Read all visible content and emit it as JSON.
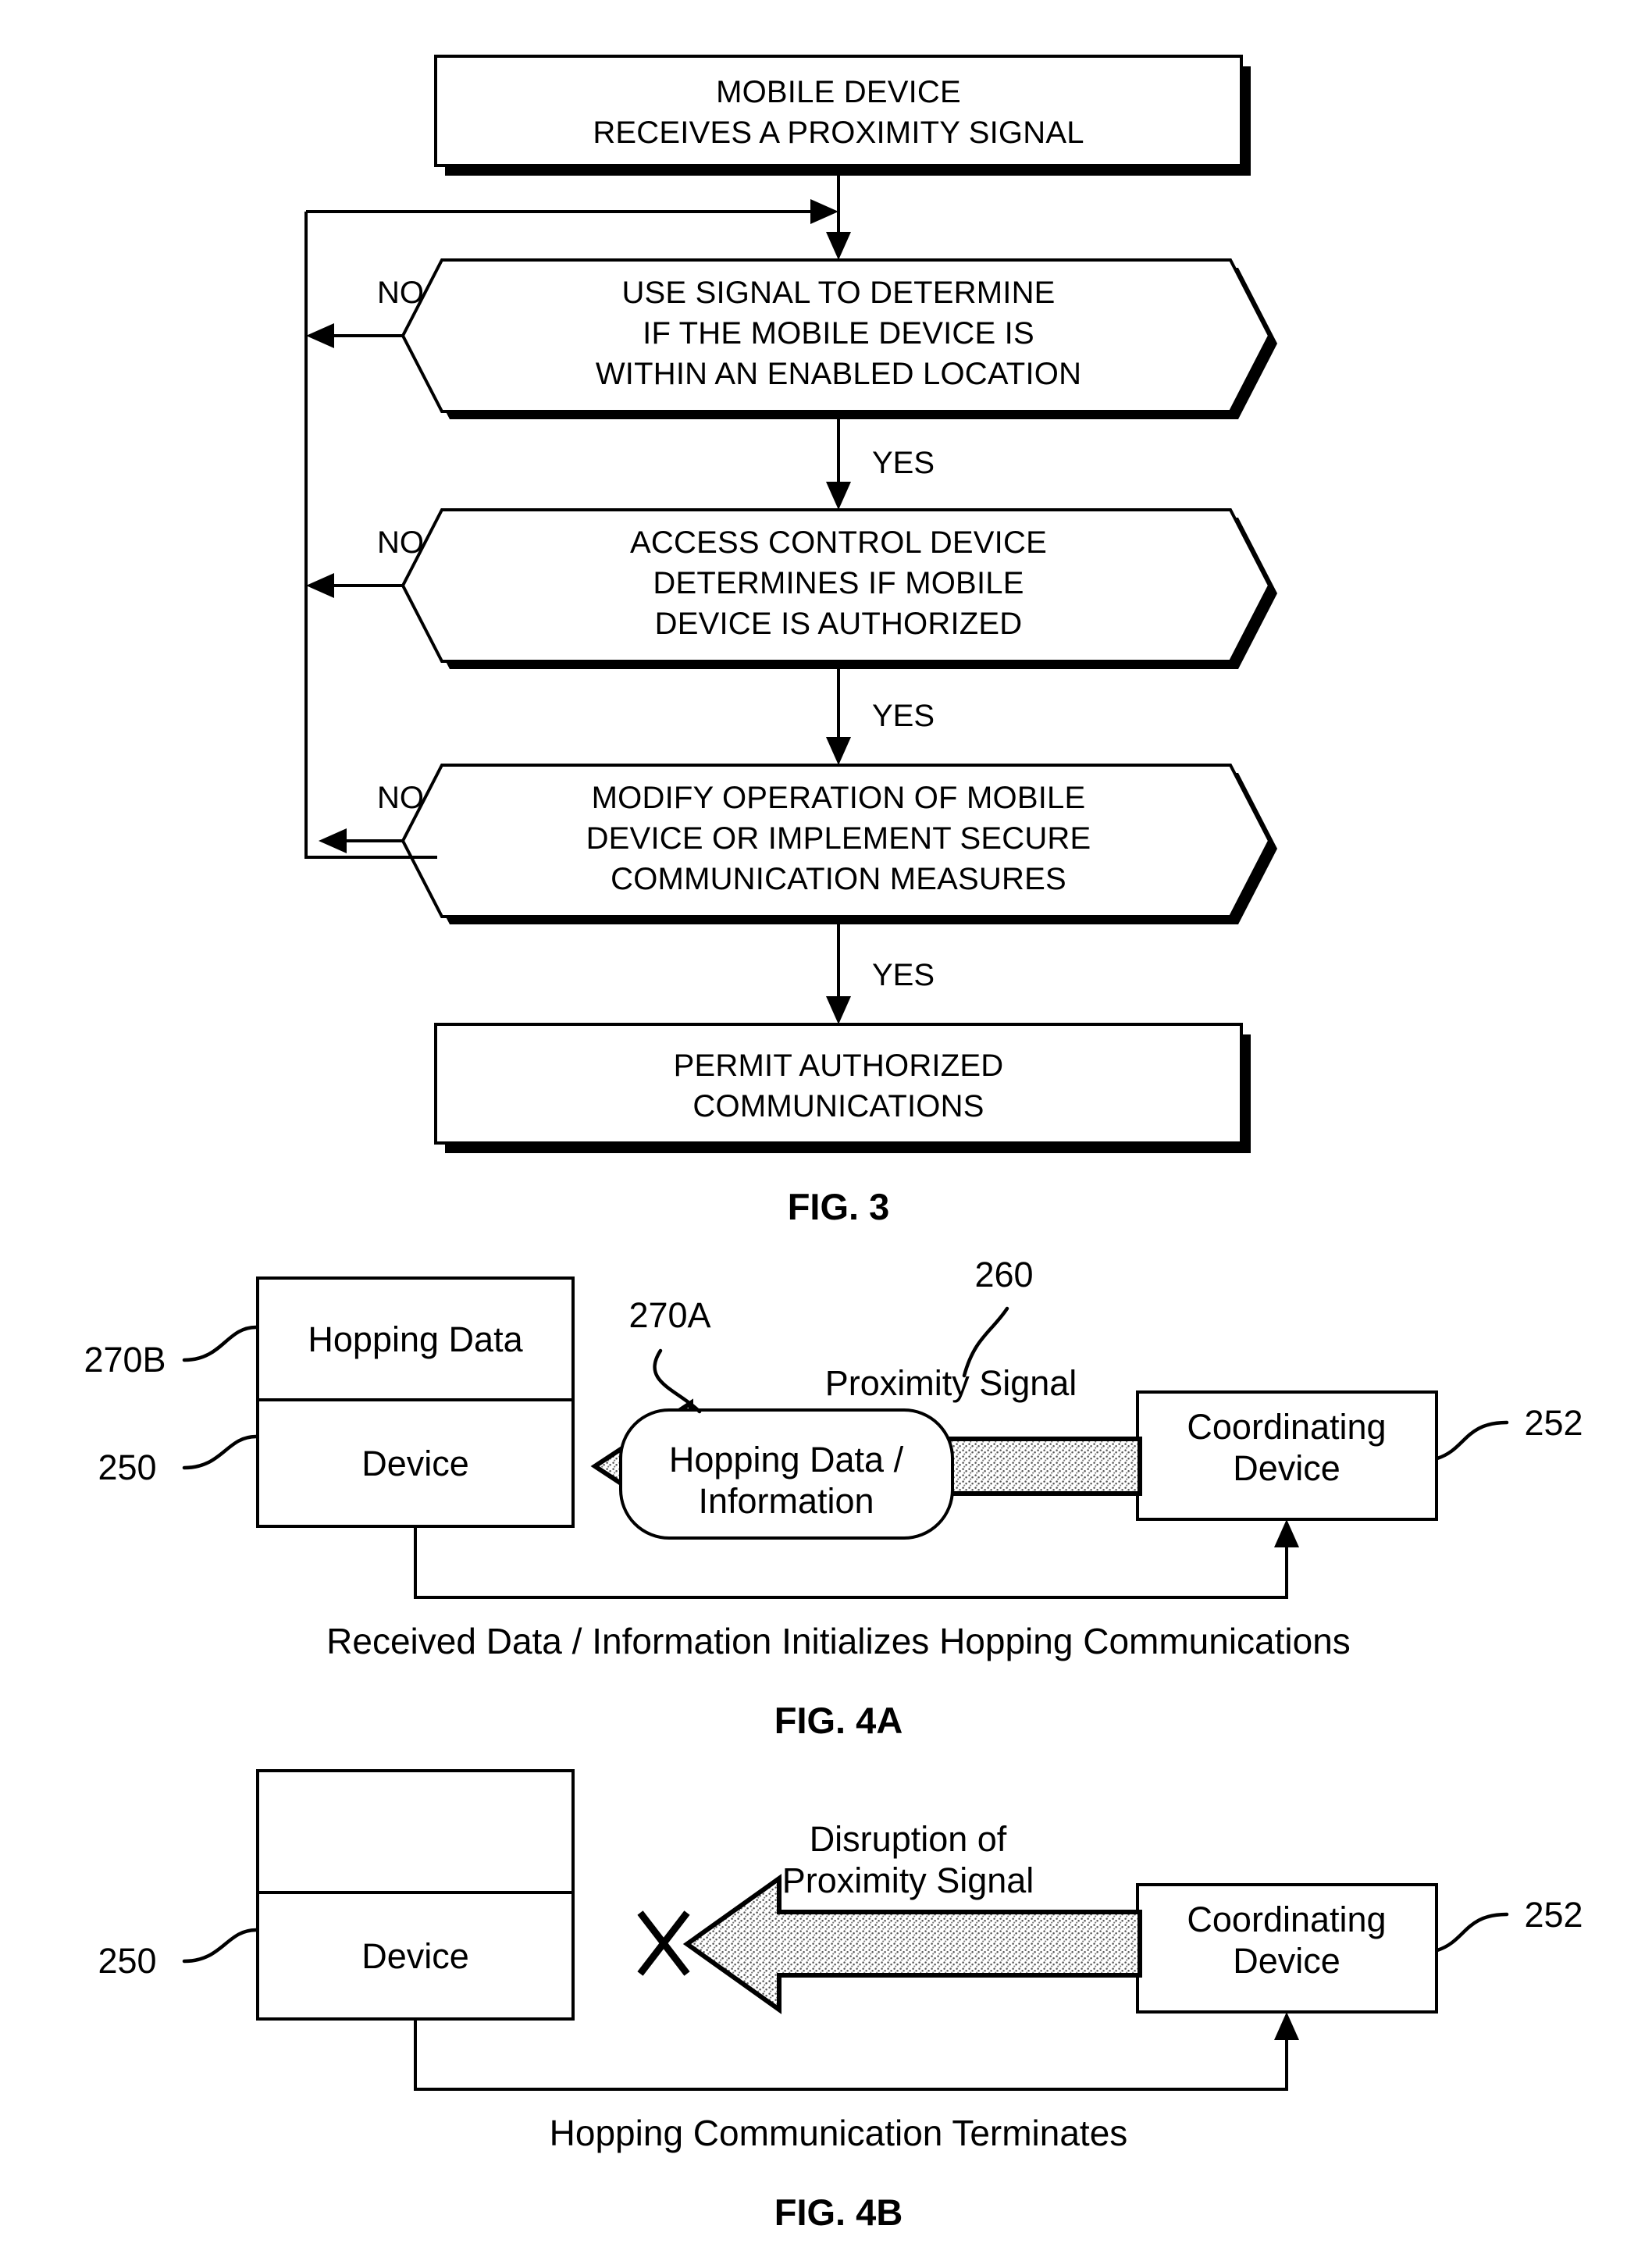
{
  "figures": [
    {
      "id": "fig3",
      "label": "FIG. 3",
      "nodes": [
        {
          "id": "n1",
          "type": "process",
          "lines": [
            "MOBILE DEVICE",
            "RECEIVES A PROXIMITY SIGNAL"
          ]
        },
        {
          "id": "n2",
          "type": "decision",
          "lines": [
            "USE SIGNAL TO DETERMINE",
            "IF THE MOBILE DEVICE IS",
            "WITHIN AN ENABLED LOCATION"
          ]
        },
        {
          "id": "n3",
          "type": "decision",
          "lines": [
            "ACCESS CONTROL DEVICE",
            "DETERMINES IF MOBILE",
            "DEVICE IS AUTHORIZED"
          ]
        },
        {
          "id": "n4",
          "type": "decision",
          "lines": [
            "MODIFY OPERATION OF MOBILE",
            "DEVICE OR IMPLEMENT SECURE",
            "COMMUNICATION MEASURES"
          ]
        },
        {
          "id": "n5",
          "type": "process",
          "lines": [
            "PERMIT AUTHORIZED",
            "COMMUNICATIONS"
          ]
        }
      ],
      "branch_labels": {
        "no1": "NO",
        "no2": "NO",
        "no3": "NO",
        "yes1": "YES",
        "yes2": "YES",
        "yes3": "YES"
      }
    },
    {
      "id": "fig4a",
      "label": "FIG. 4A",
      "caption": "Received Data / Information Initializes Hopping Communications",
      "device_box": {
        "top_cell": "Hopping Data",
        "bottom_cell": "Device"
      },
      "bubble": {
        "lines": [
          "Hopping Data /",
          "Information"
        ]
      },
      "signal_label": "Proximity Signal",
      "coordinating_box": {
        "lines": [
          "Coordinating",
          "Device"
        ]
      },
      "refs": [
        {
          "id": "ref-270b",
          "text": "270B"
        },
        {
          "id": "ref-250",
          "text": "250"
        },
        {
          "id": "ref-270a",
          "text": "270A"
        },
        {
          "id": "ref-260",
          "text": "260"
        },
        {
          "id": "ref-252",
          "text": "252"
        }
      ]
    },
    {
      "id": "fig4b",
      "label": "FIG. 4B",
      "caption": "Hopping Communication Terminates",
      "device_box": {
        "top_cell": "",
        "bottom_cell": "Device"
      },
      "signal_label_lines": [
        "Disruption of",
        "Proximity Signal"
      ],
      "coordinating_box": {
        "lines": [
          "Coordinating",
          "Device"
        ]
      },
      "refs": [
        {
          "id": "ref-250b",
          "text": "250"
        },
        {
          "id": "ref-252b",
          "text": "252"
        }
      ]
    }
  ],
  "colors": {
    "ink": "#000000",
    "paper": "#ffffff",
    "stipple": "#bdbdbd"
  }
}
